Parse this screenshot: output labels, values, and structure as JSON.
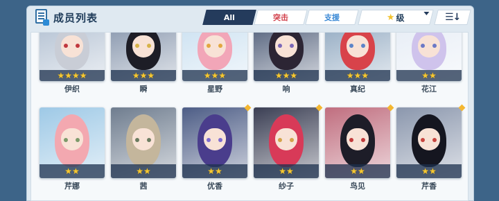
{
  "header": {
    "title": "成员列表",
    "tabs": [
      {
        "label": "All",
        "active": true
      },
      {
        "label": "突击",
        "color": "#d2404b"
      },
      {
        "label": "支援",
        "color": "#3c8ad6"
      }
    ],
    "sort_label": "级",
    "sort_icon": "star-icon",
    "order_icon": "list-sort-icon"
  },
  "members_row1": [
    {
      "name": "伊织",
      "stars": "★★★★",
      "hair": "#c9cdd6",
      "bg": "#b9c6d6",
      "eye": "#c0383f"
    },
    {
      "name": "瞬",
      "stars": "★★★",
      "hair": "#1d1d26",
      "bg": "#8f9db2",
      "eye": "#d7b34a"
    },
    {
      "name": "星野",
      "stars": "★★★",
      "hair": "#f2a6b8",
      "bg": "#cfe3f2",
      "eye": "#e3a640"
    },
    {
      "name": "响",
      "stars": "★★★",
      "hair": "#2c2534",
      "bg": "#5d6a83",
      "eye": "#7b68b8"
    },
    {
      "name": "真纪",
      "stars": "★★★",
      "hair": "#d8434a",
      "bg": "#9ab0c6",
      "eye": "#5c84c8"
    },
    {
      "name": "花江",
      "stars": "★★",
      "hair": "#cfc3ec",
      "bg": "#e8eef6",
      "eye": "#6b79c6"
    }
  ],
  "members_row2": [
    {
      "name": "芹娜",
      "stars": "★★",
      "hair": "#f3a8b0",
      "bg": "#9ec9e6",
      "eye": "#7c9a6a"
    },
    {
      "name": "茜",
      "stars": "★★",
      "hair": "#c4b69c",
      "bg": "#6f7d8f",
      "eye": "#6a7b60"
    },
    {
      "name": "优香",
      "stars": "★★",
      "hair": "#4a3d8c",
      "bg": "#4d5d86",
      "eye": "#7e6bd0",
      "new": true
    },
    {
      "name": "纱子",
      "stars": "★★",
      "hair": "#d83a58",
      "bg": "#3b3f54",
      "eye": "#d4a34a",
      "new": true
    },
    {
      "name": "鸟见",
      "stars": "★★",
      "hair": "#1d1d28",
      "bg": "#c06e7f",
      "eye": "#c13b3b",
      "new": true
    },
    {
      "name": "芹香",
      "stars": "★★",
      "hair": "#151620",
      "bg": "#8b97ad",
      "eye": "#c8453f",
      "new": true
    }
  ],
  "colors": {
    "background": "#3d6488",
    "frame": "#dfe9f1",
    "active_tab": "#243b5c",
    "star": "#f6c832"
  }
}
